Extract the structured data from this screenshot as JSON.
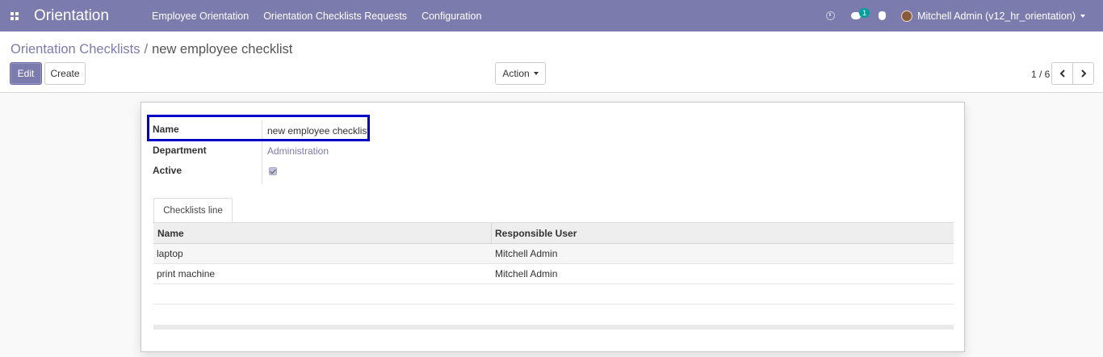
{
  "navbar": {
    "app_title": "Orientation",
    "menu": [
      "Employee Orientation",
      "Orientation Checklists Requests",
      "Configuration"
    ],
    "chat_badge": "1",
    "user_label": "Mitchell Admin (v12_hr_orientation)",
    "color": "#7c7bad"
  },
  "breadcrumb": {
    "parent": "Orientation Checklists",
    "separator": "/",
    "current": "new employee checklist"
  },
  "buttons": {
    "edit": "Edit",
    "create": "Create",
    "action": "Action"
  },
  "pager": {
    "value": "1 / 6"
  },
  "form": {
    "name_label": "Name",
    "name_value": "new employee checklist",
    "department_label": "Department",
    "department_value": "Administration",
    "active_label": "Active",
    "active_checked": true
  },
  "tab": {
    "label": "Checklists line"
  },
  "table": {
    "headers": [
      "Name",
      "Responsible User"
    ],
    "rows": [
      [
        "laptop",
        "Mitchell Admin"
      ],
      [
        "print machine",
        "Mitchell Admin"
      ]
    ]
  }
}
